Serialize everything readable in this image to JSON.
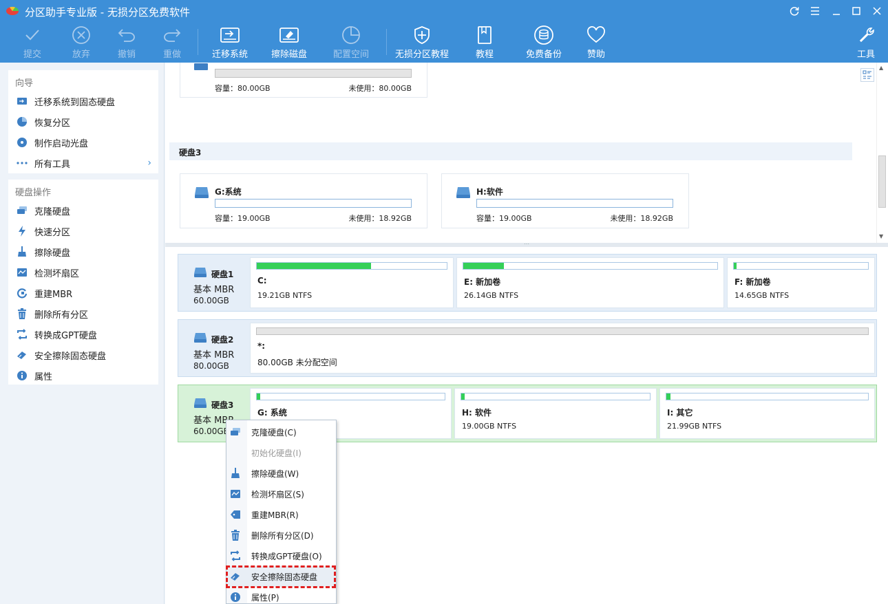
{
  "window": {
    "title": "分区助手专业版 - 无损分区免费软件",
    "buttons": [
      "refresh",
      "menu",
      "minimize",
      "maximize",
      "close"
    ]
  },
  "toolbar": {
    "items": [
      {
        "label": "提交",
        "icon": "check-icon",
        "enabled": false
      },
      {
        "label": "放弃",
        "icon": "cancel-circle-icon",
        "enabled": false
      },
      {
        "label": "撤销",
        "icon": "undo-icon",
        "enabled": false
      },
      {
        "label": "重做",
        "icon": "redo-icon",
        "enabled": false
      },
      {
        "label": "迁移系统",
        "icon": "migrate-disk-icon",
        "enabled": true
      },
      {
        "label": "擦除磁盘",
        "icon": "wipe-disk-icon",
        "enabled": true
      },
      {
        "label": "配置空间",
        "icon": "allocate-space-icon",
        "enabled": false
      },
      {
        "label": "无损分区教程",
        "icon": "shield-icon",
        "enabled": true
      },
      {
        "label": "教程",
        "icon": "book-icon",
        "enabled": true
      },
      {
        "label": "免费备份",
        "icon": "backup-icon",
        "enabled": true
      },
      {
        "label": "赞助",
        "icon": "heart-icon",
        "enabled": true
      },
      {
        "label": "工具",
        "icon": "tools-icon",
        "enabled": true
      }
    ]
  },
  "sidebar": {
    "wizard": {
      "title": "向导",
      "items": [
        "迁移系统到固态硬盘",
        "恢复分区",
        "制作启动光盘",
        "所有工具"
      ]
    },
    "disk_ops": {
      "title": "硬盘操作",
      "items": [
        "克隆硬盘",
        "快速分区",
        "擦除硬盘",
        "检测坏扇区",
        "重建MBR",
        "删除所有分区",
        "转换成GPT硬盘",
        "安全擦除固态硬盘",
        "属性"
      ]
    }
  },
  "upper": {
    "top_card": {
      "capacity": "容量：80.00GB",
      "free": "未使用：80.00GB"
    },
    "group_title": "硬盘3",
    "cards": [
      {
        "name": "G:系统",
        "capacity": "容量：19.00GB",
        "free": "未使用：18.92GB"
      },
      {
        "name": "H:软件",
        "capacity": "容量：19.00GB",
        "free": "未使用：18.92GB"
      }
    ]
  },
  "disks": [
    {
      "name": "硬盘1",
      "type": "基本 MBR",
      "size": "60.00GB",
      "partitions": [
        {
          "label": "C:",
          "info": "19.21GB NTFS",
          "used": 0.6
        },
        {
          "label": "E: 新加卷",
          "info": "26.14GB NTFS",
          "used": 0.16
        },
        {
          "label": "F: 新加卷",
          "info": "14.65GB NTFS",
          "used": 0.02
        }
      ]
    },
    {
      "name": "硬盘2",
      "type": "基本 MBR",
      "size": "80.00GB",
      "partitions": [
        {
          "label": "*:",
          "info": "80.00GB 未分配空间",
          "used": 0
        }
      ]
    },
    {
      "name": "硬盘3",
      "type": "基本 MBR",
      "size": "60.00GB",
      "partitions": [
        {
          "label": "G: 系统",
          "info": "",
          "used": 0.02
        },
        {
          "label": "H: 软件",
          "info": "19.00GB NTFS",
          "used": 0.02
        },
        {
          "label": "I: 其它",
          "info": "21.99GB NTFS",
          "used": 0.02
        }
      ]
    }
  ],
  "context_menu": {
    "items": [
      {
        "label": "克隆硬盘(C)",
        "icon": "clone-disk-icon",
        "enabled": true
      },
      {
        "label": "初始化硬盘(I)",
        "icon": "",
        "enabled": false
      },
      {
        "label": "擦除硬盘(W)",
        "icon": "broom-icon",
        "enabled": true
      },
      {
        "label": "检测坏扇区(S)",
        "icon": "sector-check-icon",
        "enabled": true
      },
      {
        "label": "重建MBR(R)",
        "icon": "tag-icon",
        "enabled": true
      },
      {
        "label": "删除所有分区(D)",
        "icon": "trash-icon",
        "enabled": true
      },
      {
        "label": "转换成GPT硬盘(O)",
        "icon": "convert-icon",
        "enabled": true
      },
      {
        "label": "安全擦除固态硬盘",
        "icon": "eraser-icon",
        "enabled": true,
        "highlighted": true
      },
      {
        "label": "属性(P)",
        "icon": "info-icon",
        "enabled": true
      }
    ]
  },
  "colors": {
    "accent": "#3d8fd8",
    "used_bar": "#34d058",
    "highlight_dash": "#e02020",
    "selected_row": "#d7f2d8"
  }
}
